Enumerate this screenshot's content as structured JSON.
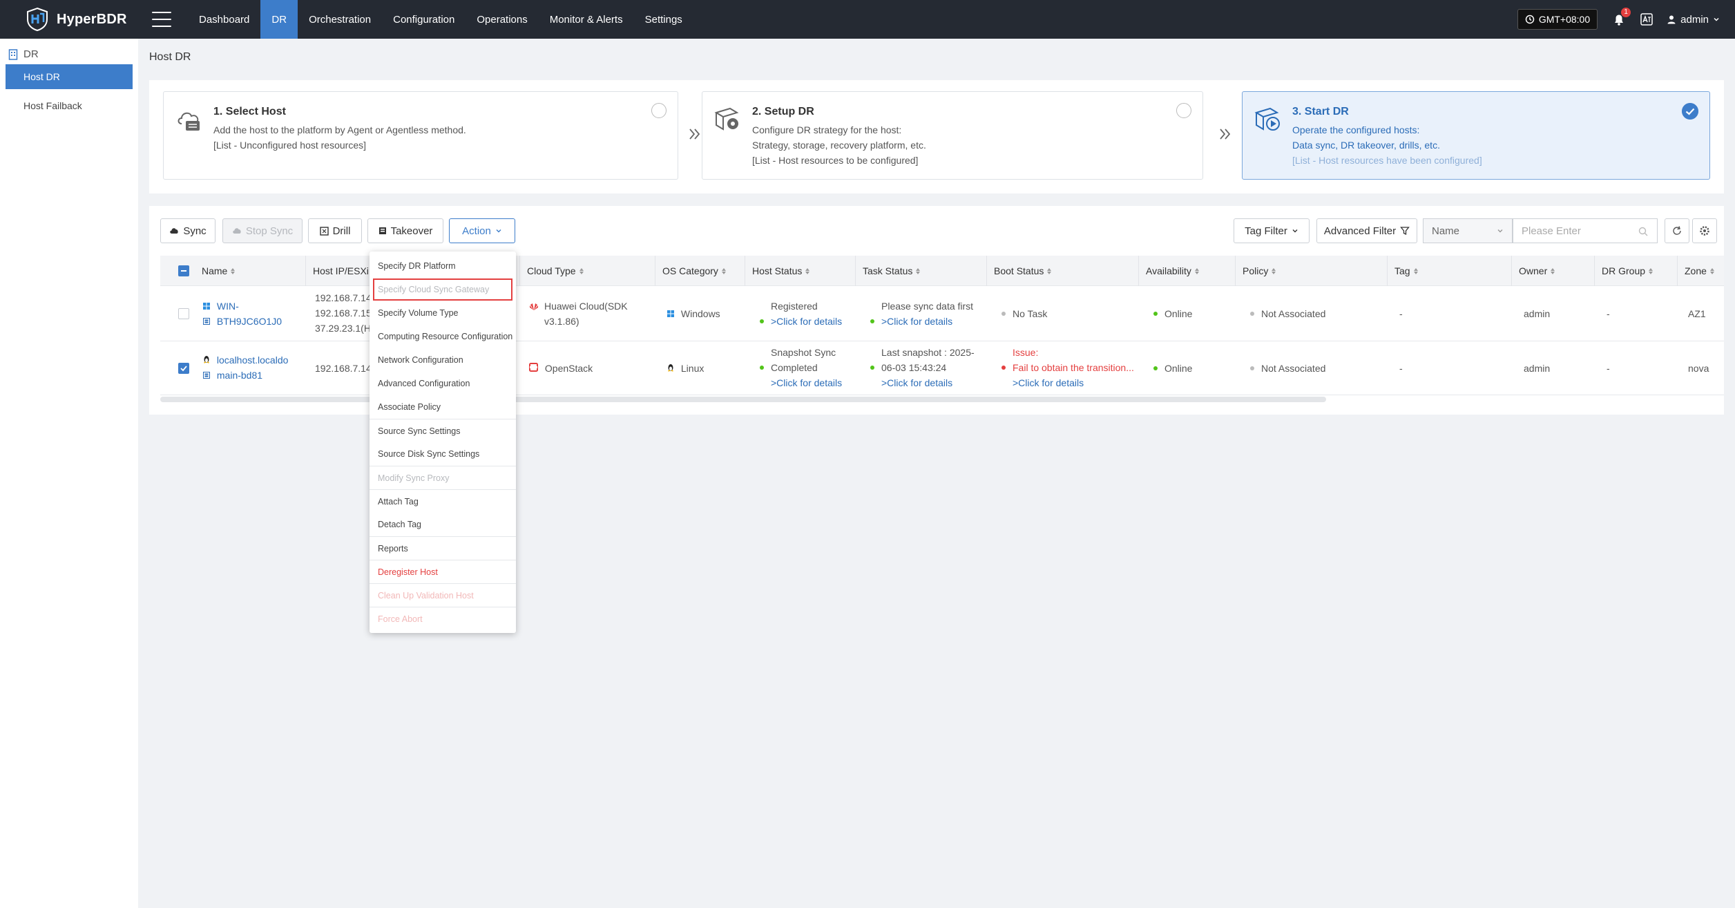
{
  "app": {
    "brand": "HyperBDR"
  },
  "nav": {
    "items": [
      "Dashboard",
      "DR",
      "Orchestration",
      "Configuration",
      "Operations",
      "Monitor & Alerts",
      "Settings"
    ],
    "active": "DR"
  },
  "topbar": {
    "timezone": "GMT+08:00",
    "alerts_count": "1",
    "user": "admin"
  },
  "sidebar": {
    "title": "DR",
    "items": [
      "Host DR",
      "Host Failback"
    ]
  },
  "breadcrumb": "Host DR",
  "steps": [
    {
      "title": "1. Select Host",
      "lines": [
        "Add the host to the platform by Agent or Agentless method.",
        "[List - Unconfigured host resources]"
      ]
    },
    {
      "title": "2. Setup DR",
      "lines": [
        "Configure DR strategy for the host:",
        "Strategy, storage, recovery platform, etc.",
        "[List - Host resources to be configured]"
      ]
    },
    {
      "title": "3. Start DR",
      "lines": [
        "Operate the configured hosts:",
        "Data sync, DR takeover, drills, etc.",
        "[List - Host resources have been configured]"
      ]
    }
  ],
  "toolbar": {
    "sync": "Sync",
    "stop_sync": "Stop Sync",
    "drill": "Drill",
    "takeover": "Takeover",
    "action": "Action",
    "tag_filter": "Tag Filter",
    "advanced_filter": "Advanced Filter",
    "search_field": "Name",
    "search_placeholder": "Please Enter"
  },
  "table": {
    "columns": [
      "Name",
      "Host IP/ESXi IP",
      "Cloud Type",
      "OS Category",
      "Host Status",
      "Task Status",
      "Boot Status",
      "Availability",
      "Policy",
      "Tag",
      "Owner",
      "DR Group",
      "Zone"
    ],
    "rows": [
      {
        "name": [
          "WIN-",
          "BTH9JC6O1J0"
        ],
        "ips": [
          "192.168.7.145(H",
          "192.168.7.150(H",
          "37.29.23.1(Host"
        ],
        "cloud_type": [
          "Huawei Cloud(SDK",
          "v3.1.86)"
        ],
        "os": "Windows",
        "host_status": [
          "Registered",
          ">Click for details"
        ],
        "task_status": [
          "Please sync data first",
          ">Click for details"
        ],
        "boot_status": [
          "No Task"
        ],
        "availability": "Online",
        "policy": "Not Associated",
        "tag": "-",
        "owner": "admin",
        "dr_group": "-",
        "zone": "AZ1",
        "checked": false
      },
      {
        "name": [
          "localhost.localdo",
          "main-bd81"
        ],
        "ips": [
          "192.168.7.143(H"
        ],
        "cloud_type": [
          "OpenStack"
        ],
        "os": "Linux",
        "host_status": [
          "Snapshot Sync",
          "Completed",
          ">Click for details"
        ],
        "task_status": [
          "Last snapshot : 2025-",
          "06-03 15:43:24",
          ">Click for details"
        ],
        "boot_status": [
          "Issue:",
          "Fail to obtain the transition...",
          ">Click for details"
        ],
        "availability": "Online",
        "policy": "Not Associated",
        "tag": "-",
        "owner": "admin",
        "dr_group": "-",
        "zone": "nova",
        "checked": true
      }
    ]
  },
  "action_menu": {
    "items": [
      {
        "label": "Specify DR Platform",
        "state": "normal"
      },
      {
        "label": "Specify Cloud Sync Gateway",
        "state": "disabled-highlighted"
      },
      {
        "label": "Specify Volume Type",
        "state": "normal"
      },
      {
        "label": "Computing Resource Configuration",
        "state": "normal"
      },
      {
        "label": "Network Configuration",
        "state": "normal"
      },
      {
        "label": "Advanced Configuration",
        "state": "normal"
      },
      {
        "label": "Associate Policy",
        "state": "normal"
      },
      {
        "label": "Source Sync Settings",
        "state": "normal"
      },
      {
        "label": "Source Disk Sync Settings",
        "state": "normal"
      },
      {
        "label": "Modify Sync Proxy",
        "state": "disabled"
      },
      {
        "label": "Attach Tag",
        "state": "normal"
      },
      {
        "label": "Detach Tag",
        "state": "normal"
      },
      {
        "label": "Reports",
        "state": "normal"
      },
      {
        "label": "Deregister Host",
        "state": "danger"
      },
      {
        "label": "Clean Up Validation Host",
        "state": "danger-disabled"
      },
      {
        "label": "Force Abort",
        "state": "danger-disabled"
      }
    ]
  },
  "colors": {
    "topbar": "#252a33",
    "accent": "#3d7dca",
    "danger": "#e43f3f",
    "online": "#52c41a"
  }
}
